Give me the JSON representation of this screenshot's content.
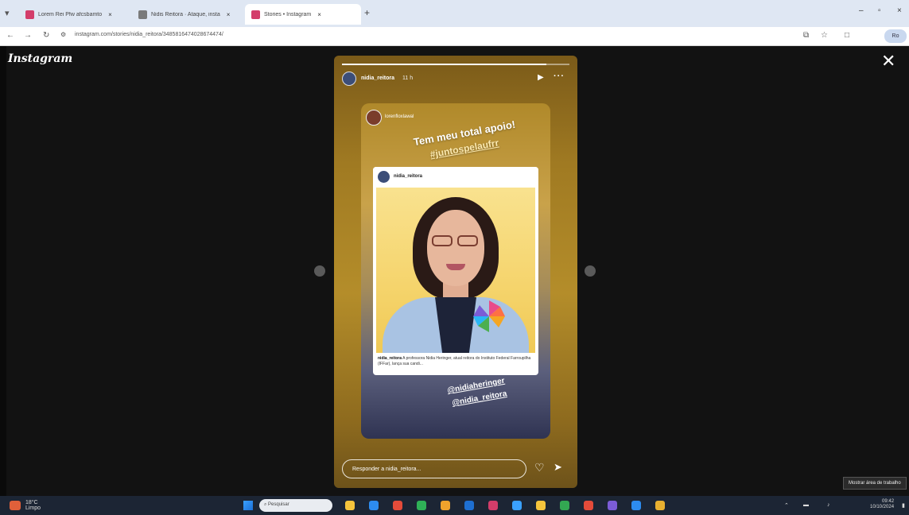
{
  "browser": {
    "tabs": [
      {
        "title": "Lorem Rei Pfw afcsbamto",
        "color": "#d33d6a"
      },
      {
        "title": "Nidis Reitora · Ataque, insta",
        "color": "#7a7a7a"
      },
      {
        "title": "Stories • Instagram",
        "color": "#d33d6a"
      }
    ],
    "url": "instagram.com/stories/nidia_reitora/3485816474028674474/",
    "profile_label": "Ro"
  },
  "story": {
    "app_logo": "Instagram",
    "username": "nidia_reitora",
    "time": "11 h",
    "progress": 0.9,
    "inner_username": "lorenfloxlawal",
    "slogan_line1": "Tem meu total apoio!",
    "slogan_line2": "#juntospelaufrr",
    "post_username": "nidia_reitora",
    "post_caption_user": "nidia_reitora",
    "post_caption_text": "A professora Nidia Heringer, atual reitora do Instituto Federal Farroupilha (IFFar), lança sua candi...",
    "mention1": "@nidiaheringer",
    "mention2": "@nidia_reitora",
    "reply_placeholder": "Responder a nidia_reitora...",
    "tooltip": "Mostrar área de trabalho"
  },
  "taskbar": {
    "weather_temp": "18°C",
    "weather_desc": "Limpo",
    "search_placeholder": "Pesquisar",
    "time": "09:42",
    "date": "10/10/2024",
    "apps": [
      "#f5c43c",
      "#2d8cf0",
      "#e44b3a",
      "#2fb157",
      "#f0a22c",
      "#1e6fd1",
      "#d33d6a",
      "#3aa1ff",
      "#f5c43c",
      "#33a852",
      "#e44b3a",
      "#7b5cd6",
      "#2d8cf0",
      "#e8b030"
    ]
  }
}
